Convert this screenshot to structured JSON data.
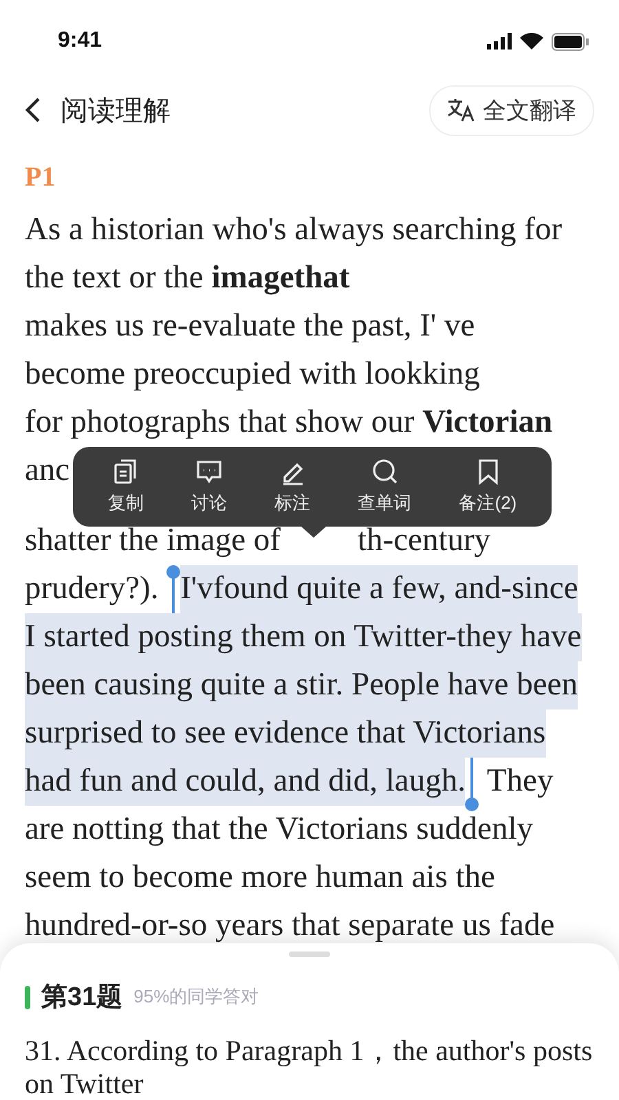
{
  "status_bar": {
    "time": "9:41"
  },
  "header": {
    "title": "阅读理解",
    "translate_button": "全文翻译"
  },
  "passage": {
    "label": "P1",
    "lines": [
      [
        {
          "text": "As a historian who's always searching for",
          "selected": false
        }
      ],
      [
        {
          "text": "the text or the **imagethat**",
          "selected": false
        }
      ],
      [
        {
          "text": "makes us re-evaluate the past, I' ve",
          "selected": false
        }
      ],
      [
        {
          "text": "become preoccupied with lookking",
          "selected": false
        }
      ],
      [
        {
          "text": "for photographs that show our **Victorian**",
          "selected": false
        }
      ],
      [
        {
          "text": "anc",
          "selected": false
        }
      ],
      [
        {
          "text": "shatter the image of",
          "selected": false
        },
        {
          "text": "th-century",
          "selected": false
        }
      ],
      [
        {
          "text": "prudery?). ",
          "selected": false
        },
        {
          "text": "I'vfound quite a few, and-since",
          "selected": true
        }
      ],
      [
        {
          "text": "I started posting them on Twitter-they have",
          "selected": true
        }
      ],
      [
        {
          "text": "been causing quite a stir. People have been",
          "selected": true
        }
      ],
      [
        {
          "text": "surprised to see evidence that Victorians",
          "selected": true
        }
      ],
      [
        {
          "text": "had fun and could, and did, laugh.",
          "selected": true
        },
        {
          "text": " They",
          "selected": false
        }
      ],
      [
        {
          "text": "are notting that the Victorians suddenly",
          "selected": false
        }
      ],
      [
        {
          "text": "seem to become more human ais the",
          "selected": false
        }
      ],
      [
        {
          "text": "hundred-or-so years that separate us fade",
          "selected": false
        }
      ]
    ]
  },
  "toolbar": [
    {
      "kind": "copy",
      "label": "复制"
    },
    {
      "kind": "discuss",
      "label": "讨论"
    },
    {
      "kind": "mark",
      "label": "标注"
    },
    {
      "kind": "lookup",
      "label": "查单词"
    },
    {
      "kind": "note",
      "label": "备注(2)"
    }
  ],
  "question": {
    "number": "第31题",
    "stat": "95%的同学答对",
    "text": "31. According to Paragraph 1，the author's posts on Twitter"
  }
}
